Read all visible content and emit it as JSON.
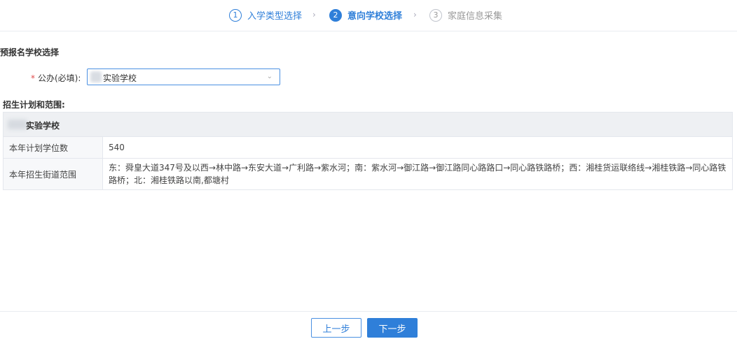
{
  "steps": [
    {
      "num": "1",
      "label": "入学类型选择"
    },
    {
      "num": "2",
      "label": "意向学校选择"
    },
    {
      "num": "3",
      "label": "家庭信息采集"
    }
  ],
  "step_separator": "›",
  "form": {
    "section_title": "预报名学校选择",
    "field_required_mark": "*",
    "field_label": "公办(必填):",
    "select_value": "实验学校",
    "select_arrow": "⌄"
  },
  "plan": {
    "title": "招生计划和范围:",
    "school_name": "实验学校",
    "rows": [
      {
        "key": "本年计划学位数",
        "value": "540"
      },
      {
        "key": "本年招生街道范围",
        "value": "东：舜皇大道347号及以西→林中路→东安大道→广利路→紫水河；南：紫水河→御江路→御江路同心路路口→同心路铁路桥；西：湘桂货运联络线→湘桂铁路→同心路铁路桥；北：湘桂铁路以南,都塘村"
      }
    ]
  },
  "buttons": {
    "prev": "上一步",
    "next": "下一步"
  }
}
